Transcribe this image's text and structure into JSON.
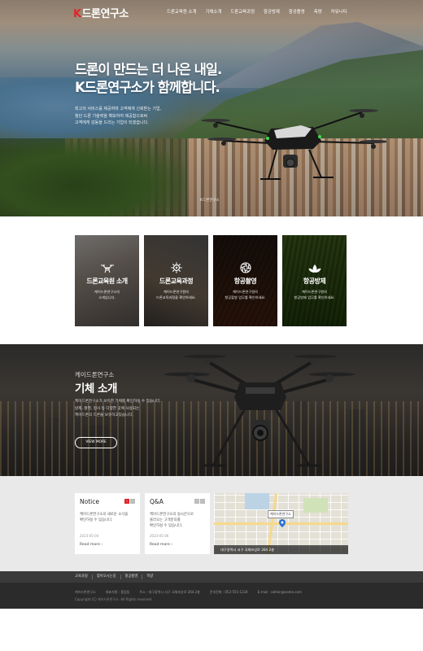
{
  "header": {
    "logo_k": "K",
    "logo_text": "드론연구소",
    "menu": [
      "드론교육원 소개",
      "기체소개",
      "드론교육과정",
      "항공방제",
      "항공촬영",
      "측량",
      "커뮤니티"
    ]
  },
  "hero": {
    "title_line1": "드론이 만드는 더 나은 내일.",
    "title_line2": "K드론연구소가 함께합니다.",
    "desc_line1": "최고의 서비스를 제공하며 고객에게 신뢰받는 기업,",
    "desc_line2": "첨단 드론 기술력을 확보하여 제공함으로써",
    "desc_line3": "고객에게 감동을 드리는 기업이 되겠습니다.",
    "caption": "K드론연구소"
  },
  "cards": [
    {
      "title": "드론교육원 소개",
      "sub1": "케이드론연구소의",
      "sub2": "소개입니다.",
      "icon": "drone-icon"
    },
    {
      "title": "드론교육과정",
      "sub1": "케이드론연구원의",
      "sub2": "드론교육과정을 확인하세요.",
      "icon": "gear-icon"
    },
    {
      "title": "항공촬영",
      "sub1": "케이드론연구원의",
      "sub2": "항공촬영 업무를 확인하세요.",
      "icon": "camera-shutter-icon"
    },
    {
      "title": "항공방제",
      "sub1": "케이드론연구원의",
      "sub2": "항공방제 업무를 확인하세요.",
      "icon": "leaf-icon"
    }
  ],
  "spec": {
    "subtitle": "케이드론연구소",
    "title": "기체 소개",
    "desc_line1": "케이드론연구소가 보유한 기체를 확인하실 수 있습니다.",
    "desc_line2": "방제, 촬영, 정사 등 다양한 곳에 사용되는",
    "desc_line3": "케이드론의 드론을 보유하고있습니다.",
    "button": "VIEW MORE"
  },
  "notice": {
    "title": "Notice",
    "body_line1": "케이드론연구소의 새로운 소식을",
    "body_line2": "확인하실 수 있습니다.",
    "date": "2023-05-04",
    "more": "Read more"
  },
  "qa": {
    "title": "Q&A",
    "body_line1": "케이드론연구소의 실시간으로",
    "body_line2": "올라오는 고객문의를",
    "body_line3": "확인하실 수 있습니다.",
    "date": "2023-05-06",
    "more": "Read more"
  },
  "map": {
    "label": "케이드론연구소",
    "address": "대구광역시 서구 국채보상로 264 2층"
  },
  "footer": {
    "links": [
      "교육과정",
      "찾아오시는길",
      "항공촬영",
      "측량"
    ],
    "company": "케이드론연구소",
    "ceo": "대표자명 : 홍길동",
    "addr": "주소 : 대구광역시 서구 국채보상로 264 2층",
    "tel": "문의전화 : 053-555-1234",
    "email": "E-mail : admin@name.com",
    "copyright": "Copyright (C) 케이드론연구소. All Rights reserved."
  }
}
